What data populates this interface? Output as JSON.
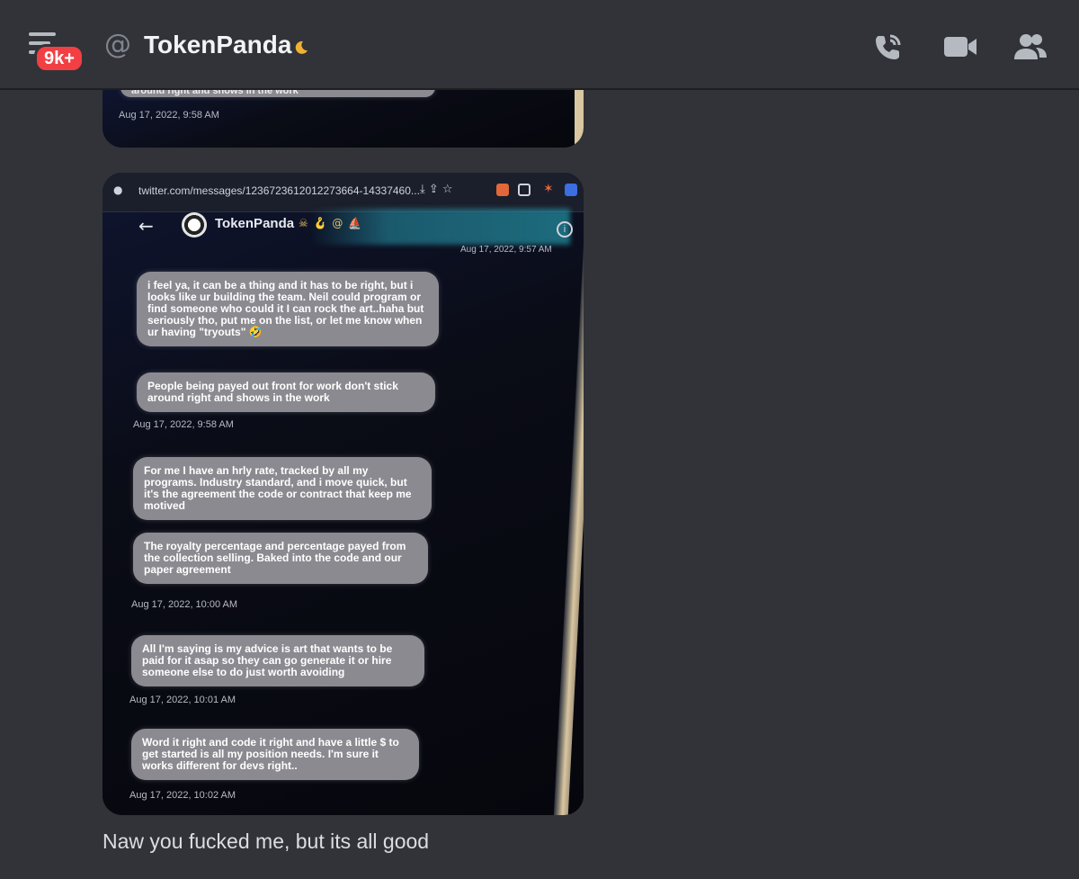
{
  "header": {
    "notification_badge": "9k+",
    "at_symbol": "@",
    "title": "TokenPanda",
    "status": "idle",
    "icons": [
      "inbox-icon",
      "voice-call-icon",
      "video-call-icon",
      "member-list-icon"
    ]
  },
  "top_attachment": {
    "partial_text": "around right and shows in the work",
    "timestamp": "Aug 17, 2022, 9:58 AM"
  },
  "main_attachment": {
    "url": "twitter.com/messages/1236723612012273664-14337460...",
    "dm_header_name": "TokenPanda",
    "dm_header_emojis": "☠ 🪝 @ ⛵",
    "top_timestamp_partial": "Aug 17, 2022, 9:57 AM",
    "messages": [
      {
        "text": "i feel ya, it can be a thing and it has to be right, but i looks like ur building the team. Neil could program or find someone who could it I can rock the art..haha but seriously tho, put me on the list, or let me know when ur having \"tryouts\" 🤣"
      },
      {
        "text": "People being payed out front for work don't stick around right and shows in the work"
      },
      {
        "text": "For me I have an hrly rate, tracked by all my programs. Industry standard, and i move quick, but it's the agreement the code or contract that keep me motived"
      },
      {
        "text": "The royalty percentage and percentage payed from the collection selling. Baked into the code and our paper agreement"
      },
      {
        "text": "All I'm saying is my advice is art that wants to be paid for it asap so they can go generate it or hire someone else to do just worth avoiding"
      },
      {
        "text": "Word it right and code it right and have a little $  to get started is all my position needs. I'm sure it works different for devs right.."
      }
    ],
    "timestamps": [
      "Aug 17, 2022, 9:58 AM",
      "Aug 17, 2022, 10:00 AM",
      "Aug 17, 2022, 10:01 AM",
      "Aug 17, 2022, 10:02 AM"
    ]
  },
  "message_text": "Naw you fucked me, but its all good",
  "colors": {
    "background": "#313338",
    "badge": "#f23f43",
    "idle_moon": "#f0b232",
    "text": "#dbdee1"
  }
}
